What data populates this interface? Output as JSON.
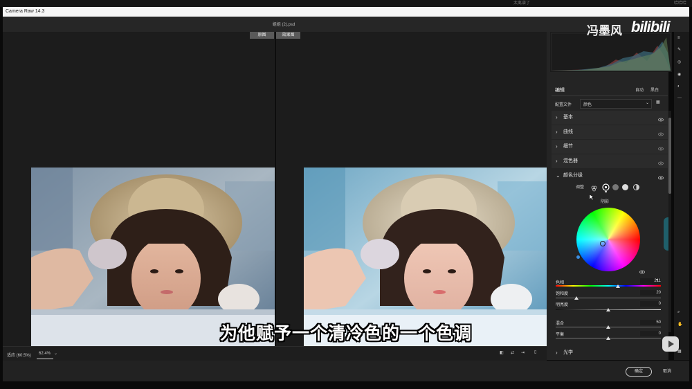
{
  "top_strip": {
    "center_text": "太离谱了",
    "right_text": "哈哈哈"
  },
  "window": {
    "title": "Camera Raw 14.3"
  },
  "document": {
    "filename": "姐姐 (2).psd"
  },
  "view_buttons": {
    "before": "原图",
    "after": "效果图"
  },
  "status": {
    "fit_label": "适应 (60.5%)",
    "zoom_value": "62.4%"
  },
  "watermark": {
    "author": "冯墨风",
    "brand": "bilibili"
  },
  "panel": {
    "edit_title": "编辑",
    "auto_label": "自动",
    "bw_label": "黑白",
    "profile_label": "配置文件",
    "profile_value": "颜色",
    "sections": [
      {
        "label": "基本"
      },
      {
        "label": "曲线"
      },
      {
        "label": "细节"
      },
      {
        "label": "混色器"
      }
    ],
    "color_grading": {
      "title": "颜色分级",
      "adjust_label": "调整",
      "wheel_label": "阴影",
      "sliders": [
        {
          "label": "色相",
          "value": "211",
          "level": 0.59
        },
        {
          "label": "饱和度",
          "value": "20",
          "level": 0.2
        },
        {
          "label": "明亮度",
          "value": "0",
          "level": 0.5
        }
      ],
      "blending_label": "混合",
      "blending_value": "50",
      "balance_label": "平衡",
      "balance_value": "0"
    },
    "optics_label": "光学"
  },
  "footer": {
    "ok_label": "确定",
    "cancel_label": "取消"
  },
  "subtitle": "为他赋予一个清冷色的一个色调",
  "colors": {
    "panel_bg": "#242424",
    "ok_border": "#cfcfcf",
    "accent_blue": "#3b8de0"
  }
}
